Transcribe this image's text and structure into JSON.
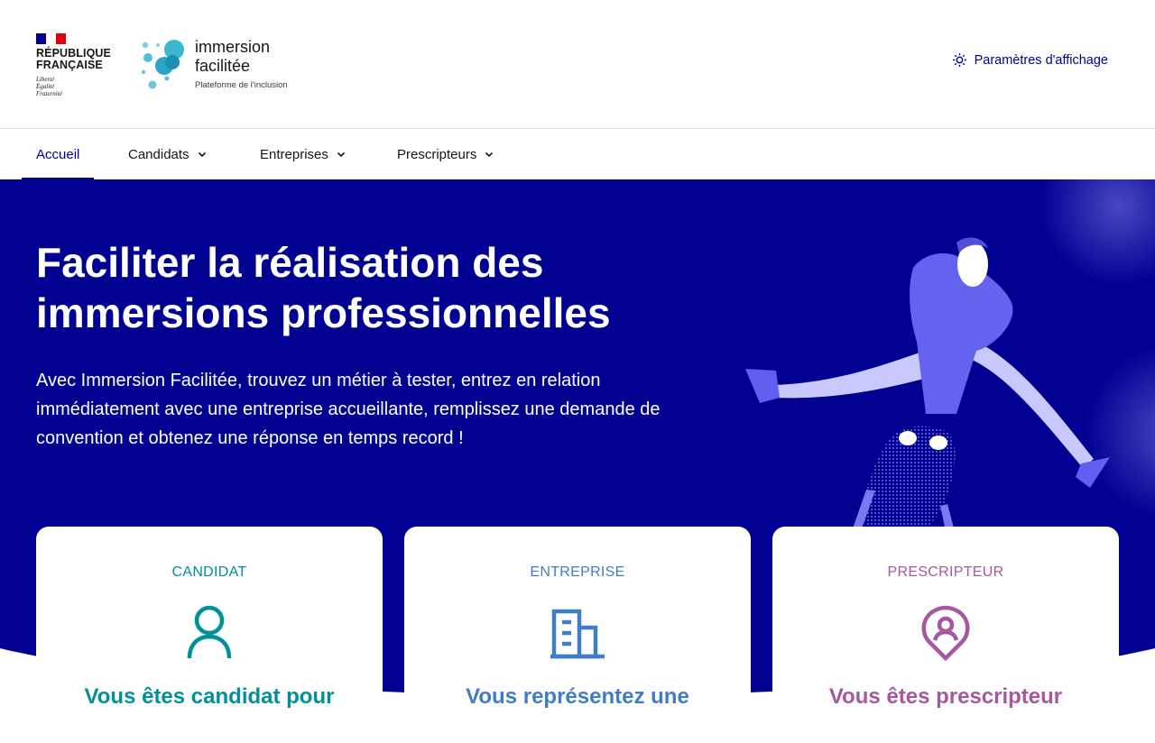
{
  "header": {
    "gov": {
      "name_line1": "RÉPUBLIQUE",
      "name_line2": "FRANÇAISE",
      "motto_line1": "Liberté",
      "motto_line2": "Égalité",
      "motto_line3": "Fraternité",
      "flag_colors": [
        "#000091",
        "#ffffff",
        "#e1000f"
      ]
    },
    "logo": {
      "line1": "immersion",
      "line2": "facilitée",
      "subtitle": "Plateforme de l'inclusion"
    },
    "display_settings": {
      "label": "Paramètres d'affichage",
      "icon": "sun-icon"
    }
  },
  "nav": {
    "items": [
      {
        "label": "Accueil",
        "active": true
      },
      {
        "label": "Candidats",
        "dropdown": true
      },
      {
        "label": "Entreprises",
        "dropdown": true
      },
      {
        "label": "Prescripteurs",
        "dropdown": true
      }
    ]
  },
  "hero": {
    "title_line1": "Faciliter la réalisation des",
    "title_line2": "immersions professionnelles",
    "description": "Avec Immersion Facilitée, trouvez un métier à tester, entrez en relation immédiatement avec une entreprise accueillante, remplissez une demande de convention et obtenez une réponse en temps record !",
    "background": "#000091"
  },
  "cards": [
    {
      "kicker": "CANDIDAT",
      "heading": "Vous êtes candidat pour",
      "icon": "user-icon",
      "color": "#009099"
    },
    {
      "kicker": "ENTREPRISE",
      "heading": "Vous représentez une",
      "icon": "building-icon",
      "color": "#417dc4"
    },
    {
      "kicker": "PRESCRIPTEUR",
      "heading": "Vous êtes prescripteur",
      "icon": "map-pin-user-icon",
      "color": "#a558a0"
    }
  ]
}
